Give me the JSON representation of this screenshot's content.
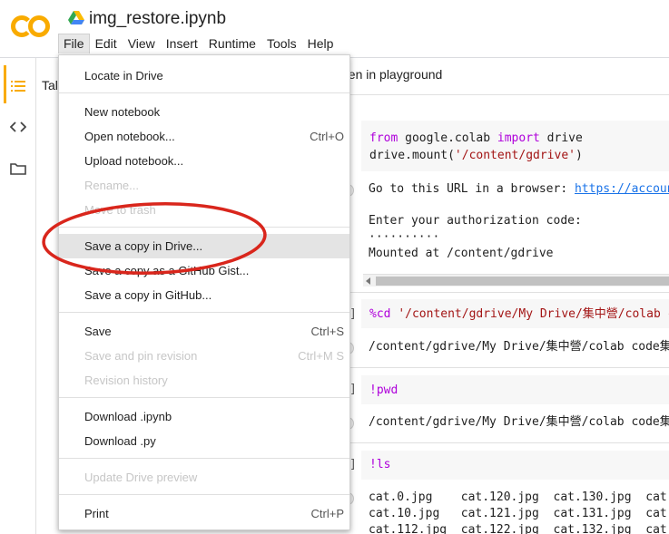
{
  "app": {
    "notebook_title": "img_restore.ipynb"
  },
  "menubar": [
    "File",
    "Edit",
    "View",
    "Insert",
    "Runtime",
    "Tools",
    "Help"
  ],
  "sidebar": {
    "toc_label": "Tal",
    "icons": [
      "toc-icon",
      "code-icon",
      "folder-icon"
    ]
  },
  "toolbar": {
    "open_playground_label": "pen in playground"
  },
  "file_menu": {
    "items": [
      {
        "label": "Locate in Drive",
        "shortcut": "",
        "disabled": false
      },
      {
        "label": "New notebook",
        "shortcut": "",
        "disabled": false
      },
      {
        "label": "Open notebook...",
        "shortcut": "Ctrl+O",
        "disabled": false
      },
      {
        "label": "Upload notebook...",
        "shortcut": "",
        "disabled": false
      },
      {
        "label": "Rename...",
        "shortcut": "",
        "disabled": true
      },
      {
        "label": "Move to trash",
        "shortcut": "",
        "disabled": true
      },
      {
        "label": "Save a copy in Drive...",
        "shortcut": "",
        "disabled": false
      },
      {
        "label": "Save a copy as a GitHub Gist...",
        "shortcut": "",
        "disabled": false
      },
      {
        "label": "Save a copy in GitHub...",
        "shortcut": "",
        "disabled": false
      },
      {
        "label": "Save",
        "shortcut": "Ctrl+S",
        "disabled": false
      },
      {
        "label": "Save and pin revision",
        "shortcut": "Ctrl+M S",
        "disabled": true
      },
      {
        "label": "Revision history",
        "shortcut": "",
        "disabled": true
      },
      {
        "label": "Download .ipynb",
        "shortcut": "",
        "disabled": false
      },
      {
        "label": "Download .py",
        "shortcut": "",
        "disabled": false
      },
      {
        "label": "Update Drive preview",
        "shortcut": "",
        "disabled": true
      },
      {
        "label": "Print",
        "shortcut": "Ctrl+P",
        "disabled": false
      }
    ]
  },
  "cells": {
    "cell1_line1_kw1": "from",
    "cell1_line1_mod": " google.colab ",
    "cell1_line1_kw2": "import",
    "cell1_line1_rest": " drive",
    "cell1_line2_a": "drive.mount(",
    "cell1_line2_str": "'/content/gdrive'",
    "cell1_line2_b": ")",
    "out1_prefix": "Go to this URL in a browser: ",
    "out1_link": "https://accoun",
    "out1_prompt": "Enter your authorization code:",
    "out1_dots": "··········",
    "out1_mounted": "Mounted at /content/gdrive",
    "cell2_bracket": "]",
    "cell2_code_a": "%cd ",
    "cell2_code_str": "'/content/gdrive/My Drive/集中營/colab c",
    "out2": "/content/gdrive/My Drive/集中營/colab code集",
    "cell3_bracket": "]",
    "cell3_code": "!pwd",
    "out3": "/content/gdrive/My Drive/集中營/colab code集",
    "cell4_bracket": "]",
    "cell4_code": "!ls",
    "ls_rows": [
      "cat.0.jpg    cat.120.jpg  cat.130.jpg  cat.",
      "cat.10.jpg   cat.121.jpg  cat.131.jpg  cat.",
      "cat.112.jpg  cat.122.jpg  cat.132.jpg  cat."
    ]
  },
  "colors": {
    "logo_orange": "#f9ab00",
    "annotation_red": "#d9261c",
    "keyword": "#af00db",
    "string": "#a31515"
  }
}
